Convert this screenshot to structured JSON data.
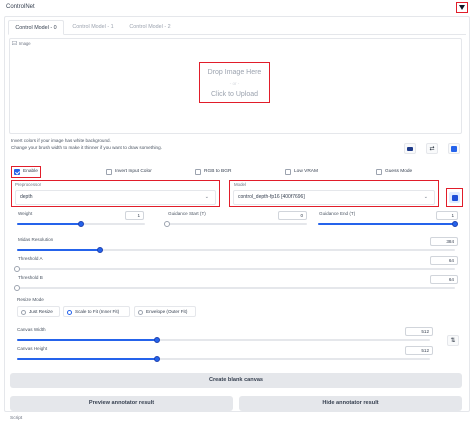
{
  "header": {
    "title": "ControlNet",
    "collapse_icon": "triangle-down-icon",
    "accent": "#e11d2a"
  },
  "tabs": [
    {
      "label": "Control Model - 0"
    },
    {
      "label": "Control Model - 1"
    },
    {
      "label": "Control Model - 2"
    }
  ],
  "image_panel": {
    "label": "Image",
    "drop_text": "Drop Image Here",
    "or_text": "- or -",
    "click_text": "Click to Upload"
  },
  "notes": {
    "line1": "Invert colors if your image has white background.",
    "line2": "Change your brush width to make it thinner if you want to draw something."
  },
  "tools": {
    "icon1": "camera-icon",
    "icon2": "swap-icon",
    "icon3": "edit-icon"
  },
  "checkboxes": {
    "enable": {
      "label": "Enable",
      "checked": true
    },
    "invert": {
      "label": "Invert Input Color",
      "checked": false
    },
    "rgb": {
      "label": "RGB to BGR",
      "checked": false
    },
    "lowvram": {
      "label": "Low VRAM",
      "checked": false
    },
    "guess": {
      "label": "Guess Mode",
      "checked": false
    }
  },
  "preprocessor": {
    "label": "Preprocessor",
    "value": "depth"
  },
  "model": {
    "label": "Model",
    "value": "control_depth-fp16 [400f7696]",
    "refresh_icon": "refresh-icon"
  },
  "sliders": {
    "weight": {
      "label": "Weight",
      "value": "1",
      "fraction": 0.5
    },
    "guidance_start": {
      "label": "Guidance Start (T)",
      "value": "0",
      "fraction": 0.0
    },
    "guidance_end": {
      "label": "Guidance End (T)",
      "value": "1",
      "fraction": 1.0
    },
    "midas": {
      "label": "Midas Resolution",
      "value": "384",
      "fraction": 0.19
    },
    "threshold_a": {
      "label": "Threshold A",
      "value": "64",
      "fraction": 0.0
    },
    "threshold_b": {
      "label": "Threshold B",
      "value": "64",
      "fraction": 0.0
    }
  },
  "resize_mode": {
    "label": "Resize Mode",
    "options": [
      {
        "label": "Just Resize",
        "selected": false
      },
      {
        "label": "Scale to Fit (Inner Fit)",
        "selected": true
      },
      {
        "label": "Envelope (Outer Fit)",
        "selected": false
      }
    ]
  },
  "canvas": {
    "width": {
      "label": "Canvas Width",
      "value": "512",
      "fraction": 0.34
    },
    "height": {
      "label": "Canvas Height",
      "value": "512",
      "fraction": 0.34
    },
    "swap_icon": "swap-vertical-icon"
  },
  "buttons": {
    "create_canvas": "Create blank canvas",
    "preview": "Preview annotator result",
    "hide": "Hide annotator result"
  },
  "footer": {
    "script_label": "Script"
  }
}
